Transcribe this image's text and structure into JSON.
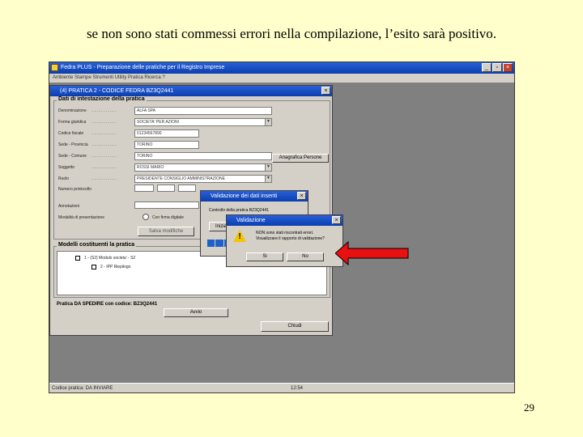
{
  "caption": "se non sono stati commessi errori nella compilazione, l’esito sarà positivo.",
  "page_number": "29",
  "app": {
    "title": "Fedra PLUS - Preparazione delle pratiche per il Registro Imprese",
    "menu": "Ambiente   Stampe   Strumenti   Utility   Pratica   Ricerca   ?",
    "status_left": "Codice pratica: DA INVIARE",
    "status_right": "12:54"
  },
  "pratica_dialog": {
    "title": "(4) PRATICA 2 - CODICE FEDRA BZ3Q2441",
    "group_title": "Dati di intestazione della pratica",
    "fields": [
      {
        "label": "Denominazione",
        "value": "ALFA SPA"
      },
      {
        "label": "Forma giuridica",
        "value": "SOCIETA' PER AZIONI"
      },
      {
        "label": "Codice fiscale",
        "value": "01234567890"
      },
      {
        "label": "Sede - Provincia",
        "value": "TORINO"
      },
      {
        "label": "Sede - Comune",
        "value": "TORINO"
      },
      {
        "label": "Soggetto",
        "value": "ROSSI MARIO"
      },
      {
        "label": "Ruolo",
        "value": "PRESIDENTE CONSIGLIO AMMINISTRAZIONE"
      }
    ],
    "anagrafica_button": "Anagrafica Persone",
    "extra_labels": [
      "Numero protocollo",
      "Annotazioni",
      "Modalità di presentazione"
    ],
    "radio_label": "Con firma digitale",
    "salva_button": "Salva modifiche",
    "modelli_title": "Modelli costituenti la pratica",
    "tree_items": [
      "1 - (S2) Modulo societa' - S2",
      "2 - IPP Riepilogo"
    ],
    "footer_title": "Pratica DA SPEDIRE con codice: BZ3Q2441",
    "avvio_button": "Avvio",
    "chiudi_button": "Chiudi"
  },
  "validazione_dati": {
    "title": "Validazione dei dati inseriti",
    "text": "Controllo della pratica BZ3Q2441",
    "button_partial": "Inizia"
  },
  "validazione_msg": {
    "title": "Validazione",
    "message_line1": "NON sono stati riscontrati errori.",
    "message_line2": "Visualizzare il rapporto di validazione?",
    "si_button": "Si",
    "no_button": "No"
  },
  "colors": {
    "background": "#FFFFCC",
    "arrow": "#E81010",
    "titlebar": "#0A3FB0"
  }
}
